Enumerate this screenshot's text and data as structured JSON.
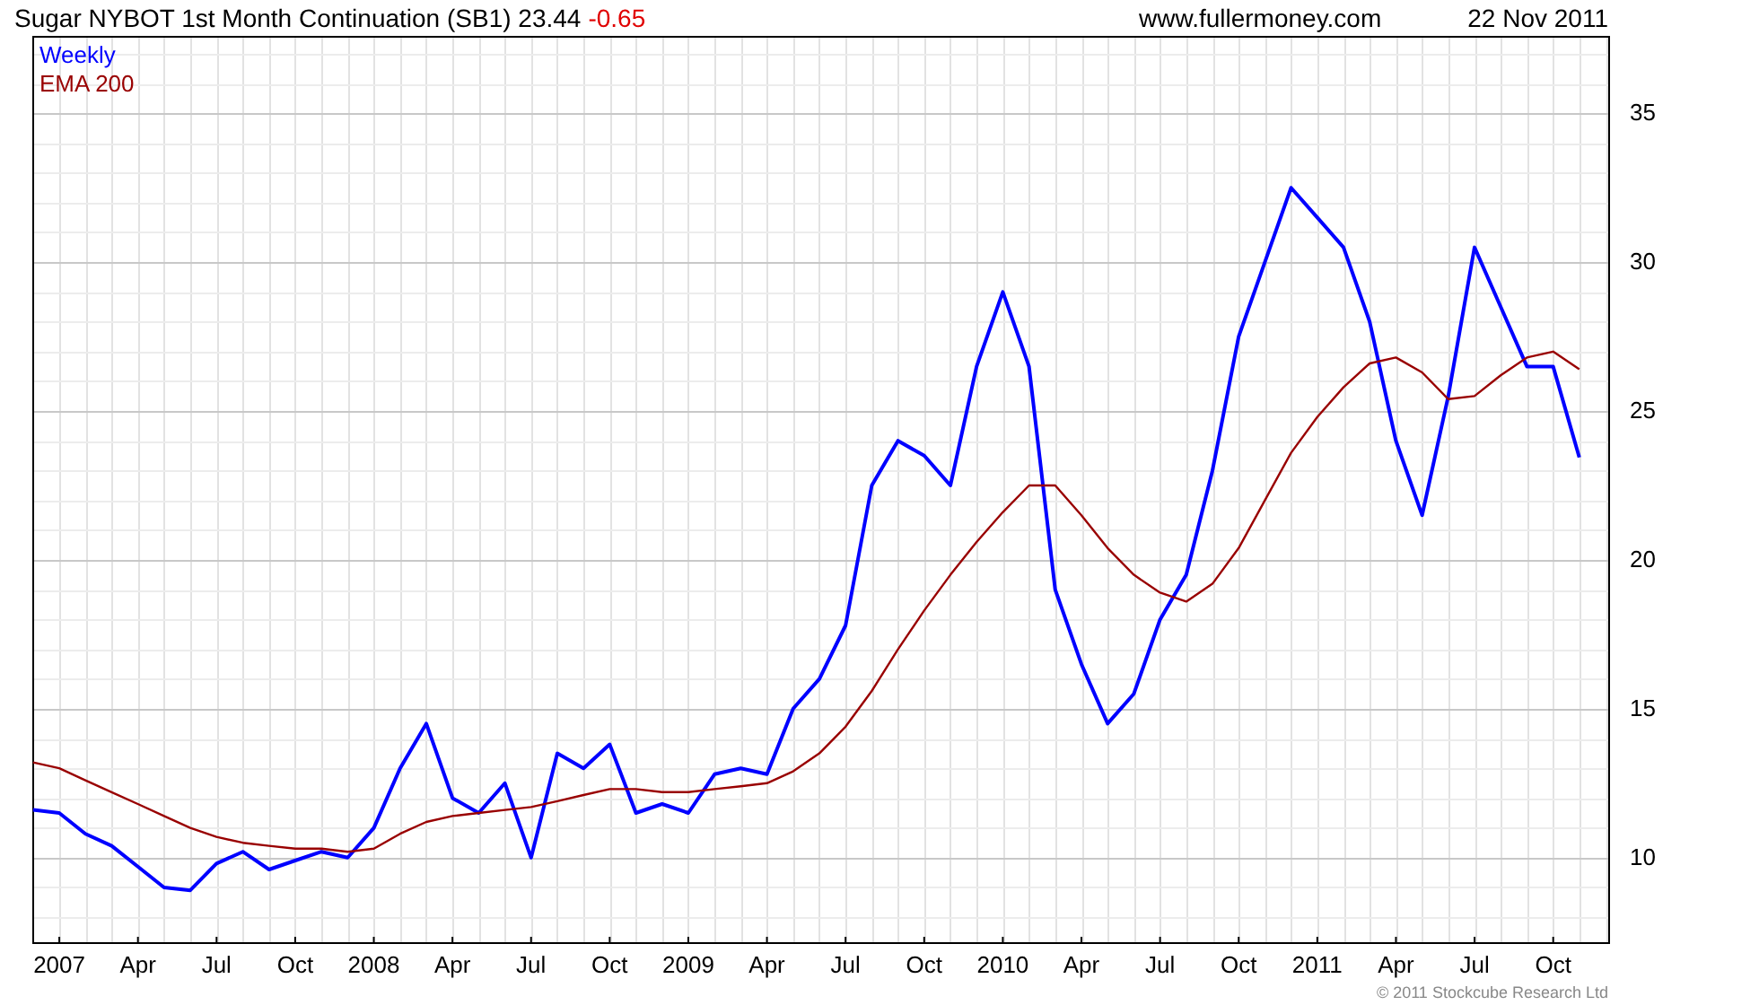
{
  "header": {
    "title": "Sugar NYBOT 1st Month Continuation (SB1) 23.44",
    "change": "-0.65",
    "site": "www.fullermoney.com",
    "date": "22 Nov 2011"
  },
  "chart": {
    "chart_data": {
      "type": "line",
      "categories": [
        null,
        "2007",
        null,
        null,
        "Apr",
        null,
        null,
        "Jul",
        null,
        null,
        "Oct",
        null,
        null,
        "2008",
        null,
        null,
        "Apr",
        null,
        null,
        "Jul",
        null,
        null,
        "Oct",
        null,
        null,
        "2009",
        null,
        null,
        "Apr",
        null,
        null,
        "Jul",
        null,
        null,
        "Oct",
        null,
        null,
        "2010",
        null,
        null,
        "Apr",
        null,
        null,
        "Jul",
        null,
        null,
        "Oct",
        null,
        null,
        "2011",
        null,
        null,
        "Apr",
        null,
        null,
        "Jul",
        null,
        null,
        "Oct",
        null
      ],
      "series": [
        {
          "name": "Weekly",
          "color": "#0000ff",
          "values": [
            11.6,
            11.5,
            10.8,
            10.4,
            9.7,
            9.0,
            8.9,
            9.8,
            10.2,
            9.6,
            9.9,
            10.2,
            10.0,
            11.0,
            13.0,
            14.5,
            12.0,
            11.5,
            12.5,
            10.0,
            13.5,
            13.0,
            13.8,
            11.5,
            11.8,
            11.5,
            12.8,
            13.0,
            12.8,
            15.0,
            16.0,
            17.8,
            22.5,
            24.0,
            23.5,
            22.5,
            26.5,
            29.0,
            26.5,
            19.0,
            16.5,
            14.5,
            15.5,
            18.0,
            19.5,
            23.0,
            27.5,
            30.0,
            32.5,
            31.5,
            30.5,
            28.0,
            24.0,
            21.5,
            25.5,
            30.5,
            28.5,
            26.5,
            26.5,
            23.44
          ]
        },
        {
          "name": "EMA 200",
          "color": "#990000",
          "values": [
            13.2,
            13.0,
            12.6,
            12.2,
            11.8,
            11.4,
            11.0,
            10.7,
            10.5,
            10.4,
            10.3,
            10.3,
            10.2,
            10.3,
            10.8,
            11.2,
            11.4,
            11.5,
            11.6,
            11.7,
            11.9,
            12.1,
            12.3,
            12.3,
            12.2,
            12.2,
            12.3,
            12.4,
            12.5,
            12.9,
            13.5,
            14.4,
            15.6,
            17.0,
            18.3,
            19.5,
            20.6,
            21.6,
            22.5,
            22.5,
            21.5,
            20.4,
            19.5,
            18.9,
            18.6,
            19.2,
            20.4,
            22.0,
            23.6,
            24.8,
            25.8,
            26.6,
            26.8,
            26.3,
            25.4,
            25.5,
            26.2,
            26.8,
            27.0,
            26.4
          ]
        }
      ],
      "ylim": [
        7.1,
        37.6
      ],
      "grid": true,
      "yticks": [
        10,
        15,
        20,
        25,
        30,
        35
      ]
    }
  },
  "footer": {
    "copyright": "© 2011 Stockcube Research Ltd"
  }
}
